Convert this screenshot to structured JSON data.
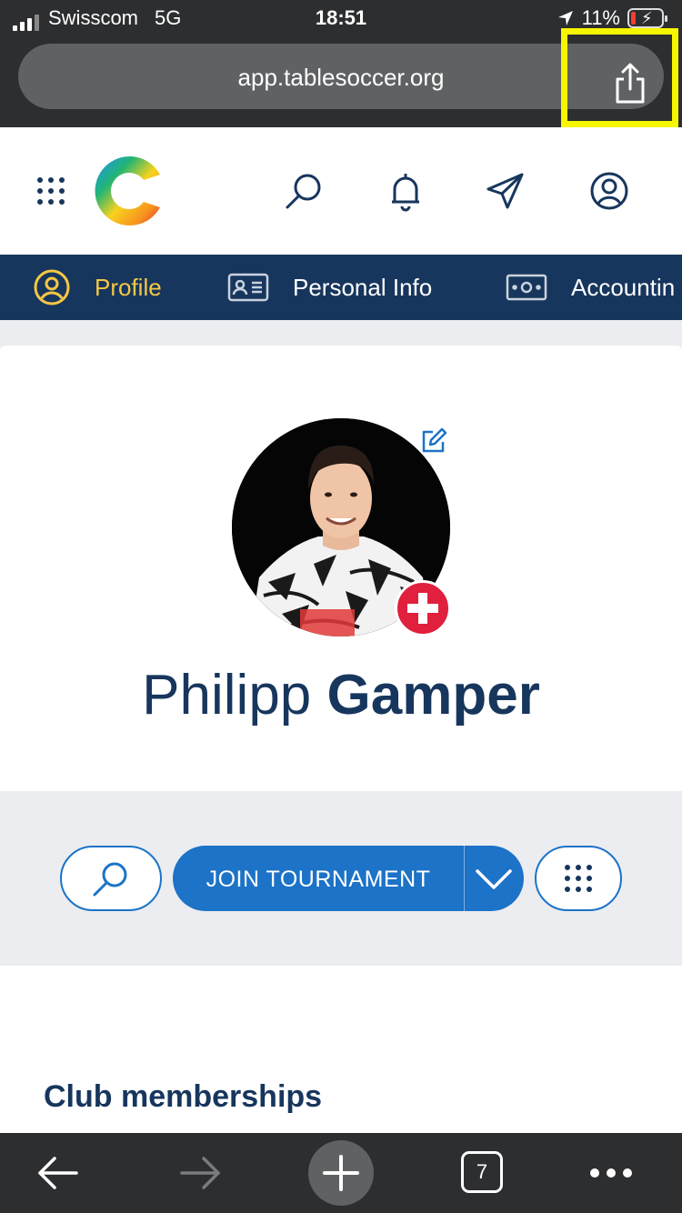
{
  "status_bar": {
    "carrier": "Swisscom",
    "network": "5G",
    "time": "18:51",
    "battery_percent": "11%"
  },
  "browser": {
    "url": "app.tablesoccer.org",
    "share_icon": "share-icon",
    "open_tabs": "7"
  },
  "header": {
    "icons": [
      "apps-grid-icon",
      "search-icon",
      "bell-icon",
      "send-icon",
      "account-icon"
    ]
  },
  "tabs": [
    {
      "label": "Profile",
      "icon": "user-circle-icon",
      "active": true
    },
    {
      "label": "Personal Info",
      "icon": "id-card-icon",
      "active": false
    },
    {
      "label": "Accountin",
      "icon": "money-icon",
      "active": false
    }
  ],
  "profile": {
    "first_name": "Philipp",
    "last_name": "Gamper",
    "country_flag": "switzerland-flag-icon"
  },
  "actions": {
    "join_label": "JOIN TOURNAMENT"
  },
  "clubs": {
    "title": "Club memberships"
  },
  "colors": {
    "navy": "#17365d",
    "primary_blue": "#1c73c7",
    "active_tab": "#f6c744",
    "highlight": "#f6f600",
    "browser_chrome": "#2d2e30"
  }
}
